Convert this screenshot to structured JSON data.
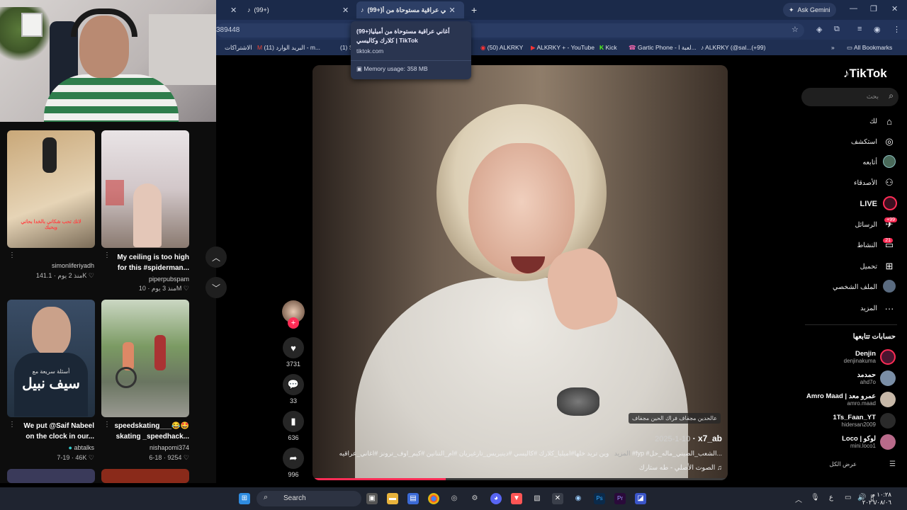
{
  "browser": {
    "tabs": [
      {
        "label": "(99+)"
      },
      {
        "label": "(99+)أغاني عراقية مستوحاة من أ..."
      }
    ],
    "ask_gemini": "Ask Gemini",
    "address_partial": "389448",
    "bookmarks": [
      "الاشتراكات",
      "(11) البريد الوارد - m...",
      "(1) S",
      "(50) ALKRKY",
      "ALKRKY + - YouTube",
      "Kick",
      "Gartic Phone - لعبة ا...",
      "ALKRKY (@sal...(+99)"
    ],
    "all_bookmarks": "All Bookmarks",
    "tooltip": {
      "title_line1": "(99+)أغاني عراقية مستوحاة من أميليا",
      "title_line2": "كلارك وكاليسي | TikTok",
      "domain": "tiktok.com",
      "memory": "Memory usage: 358 MB"
    }
  },
  "left_grid": {
    "cards": [
      {
        "user": "simonliferiyadh",
        "likes": "141.1K",
        "age": "منذ 2 يوم",
        "caption_1": "",
        "caption_2": "",
        "thumb_text": "لانك تحب شكاني بالخدا بحاني\nوبحبك"
      },
      {
        "user": "piperpubspam",
        "likes": "10M",
        "age": "منذ 3 يوم",
        "caption_1": "My ceiling is too high",
        "caption_2": "for this #spiderman..."
      },
      {
        "user": "abtalks",
        "likes": "46K",
        "age": "7-19",
        "caption_1": "We put @Saif Nabeel",
        "caption_2": "on the clock in our...",
        "thumb_text_small": "أسئلة سريعة مع",
        "thumb_text_big": "سيف نبيل"
      },
      {
        "user": "nishapomi374",
        "likes": "9254",
        "age": "6-18",
        "caption_1": "speedskating___😂🤩",
        "caption_2": "skating _speedhack..."
      }
    ]
  },
  "video": {
    "subtitle": "عالحدين مجفاف فراك الحين مجفاف",
    "username": "x7_ab",
    "date": "2025-1-10",
    "description": "وين تريد خلها#اميليا_كلارك #كاليسي #دينيريس_تارغيريان #ام_التنانين #كيم_اوف_ترونز #اغاني_عراقيه #fyp #الشعب_الصيني_ماله_حل...",
    "more": "المزيد",
    "sound": "الصوت الأصلي - طه ستارك",
    "progress": 0.32
  },
  "actions": {
    "likes": "3731",
    "comments": "33",
    "saves": "636",
    "shares": "996"
  },
  "sidebar": {
    "logo": "TikTok",
    "search_placeholder": "بحث",
    "nav": [
      {
        "label": "لك",
        "icon": "home-icon"
      },
      {
        "label": "استكشف",
        "icon": "compass-icon"
      },
      {
        "label": "أتابعه",
        "icon": "following-icon"
      },
      {
        "label": "الأصدقاء",
        "icon": "friends-icon"
      },
      {
        "label": "LIVE",
        "icon": "live-icon"
      },
      {
        "label": "الرسائل",
        "icon": "messages-icon",
        "badge": "+99"
      },
      {
        "label": "النشاط",
        "icon": "activity-icon",
        "badge": "21"
      },
      {
        "label": "تحميل",
        "icon": "upload-icon"
      },
      {
        "label": "الملف الشخصي",
        "icon": "profile-icon"
      },
      {
        "label": "المزيد",
        "icon": "more-icon"
      }
    ],
    "following_title": "حسابات تتابعها",
    "following": [
      {
        "name": "Denjin",
        "handle": "denjinakuma"
      },
      {
        "name": "حمدمد",
        "handle": "ahd7o"
      },
      {
        "name": "Amro Maad | عمرو معد",
        "handle": "amro.maad"
      },
      {
        "name": "1Ts_Faan_YT",
        "handle": "hidersan2009"
      },
      {
        "name": "Loco | لوكو",
        "handle": "mini.loco1"
      }
    ],
    "see_all": "عرض الكل"
  },
  "taskbar": {
    "search": "Search",
    "time": "١٠:٢٨ م",
    "date": "٢٠٢٦/٠٨/٠٦",
    "lang": "ع"
  },
  "colors": {
    "accent": "#fe2c55",
    "chrome_bg": "#1b2a4a"
  }
}
